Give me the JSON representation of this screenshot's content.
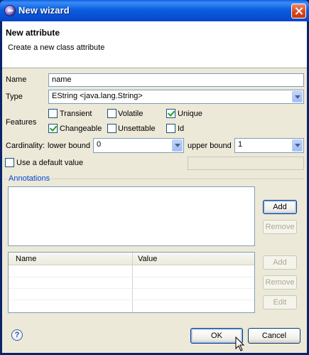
{
  "window": {
    "title": "New wizard"
  },
  "header": {
    "title": "New attribute",
    "description": "Create a new class attribute"
  },
  "form": {
    "name_label": "Name",
    "name_value": "name",
    "type_label": "Type",
    "type_value": "EString <java.lang.String>",
    "features_label": "Features",
    "features": [
      {
        "label": "Transient",
        "checked": false
      },
      {
        "label": "Volatile",
        "checked": false
      },
      {
        "label": "Unique",
        "checked": true
      },
      {
        "label": "Changeable",
        "checked": true
      },
      {
        "label": "Unsettable",
        "checked": false
      },
      {
        "label": "Id",
        "checked": false
      }
    ],
    "cardinality_label": "Cardinality:",
    "lower_bound_label": "lower bound",
    "lower_bound_value": "0",
    "upper_bound_label": "upper bound",
    "upper_bound_value": "1",
    "default_value_label": "Use a default value",
    "default_value_checked": false,
    "default_value": ""
  },
  "annotations": {
    "group_title": "Annotations",
    "add_label": "Add",
    "remove_label": "Remove",
    "table": {
      "columns": [
        "Name",
        "Value"
      ],
      "rows": []
    },
    "detail_add_label": "Add",
    "detail_remove_label": "Remove",
    "detail_edit_label": "Edit"
  },
  "footer": {
    "help_glyph": "?",
    "ok_label": "OK",
    "cancel_label": "Cancel"
  },
  "icons": {
    "app": "eclipse-icon",
    "close": "close-icon",
    "help": "help-icon",
    "cursor": "mouse-pointer-icon"
  }
}
